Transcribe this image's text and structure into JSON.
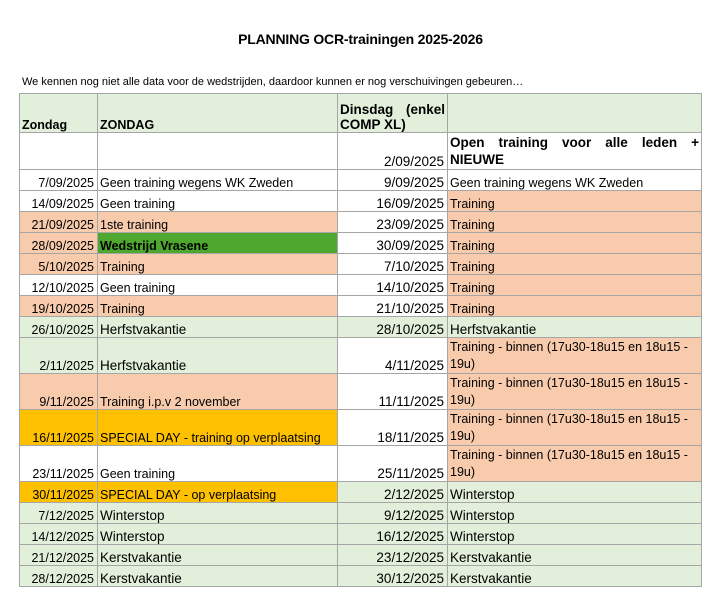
{
  "title": "PLANNING OCR-trainingen 2025-2026",
  "note": "We kennen nog niet alle data voor de wedstrijden, daardoor kunnen er nog verschuivingen gebeuren…",
  "header": {
    "col1": "Zondag",
    "col2": "ZONDAG",
    "col3": "Dinsdag (enkel COMP XL)",
    "col4": ""
  },
  "rows": [
    {
      "d1": "",
      "t1": "",
      "d2": "2/09/2025",
      "t2": "Open training voor alle leden + NIEUWE"
    },
    {
      "d1": "7/09/2025",
      "t1": "Geen training wegens WK Zweden",
      "d2": "9/09/2025",
      "t2": "Geen training wegens WK Zweden"
    },
    {
      "d1": "14/09/2025",
      "t1": "Geen training",
      "d2": "16/09/2025",
      "t2": "Training"
    },
    {
      "d1": "21/09/2025",
      "t1": "1ste training",
      "d2": "23/09/2025",
      "t2": "Training"
    },
    {
      "d1": "28/09/2025",
      "t1": "Wedstrijd Vrasene",
      "d2": "30/09/2025",
      "t2": "Training"
    },
    {
      "d1": "5/10/2025",
      "t1": "Training",
      "d2": "7/10/2025",
      "t2": "Training"
    },
    {
      "d1": "12/10/2025",
      "t1": "Geen training",
      "d2": "14/10/2025",
      "t2": "Training"
    },
    {
      "d1": "19/10/2025",
      "t1": "Training",
      "d2": "21/10/2025",
      "t2": "Training"
    },
    {
      "d1": "26/10/2025",
      "t1": "Herfstvakantie",
      "d2": "28/10/2025",
      "t2": "Herfstvakantie"
    },
    {
      "d1": "2/11/2025",
      "t1": "Herfstvakantie",
      "d2": "4/11/2025",
      "t2": "Training - binnen (17u30-18u15 en 18u15 - 19u)"
    },
    {
      "d1": "9/11/2025",
      "t1": "Training i.p.v 2 november",
      "d2": "11/11/2025",
      "t2": "Training - binnen (17u30-18u15 en 18u15 - 19u)"
    },
    {
      "d1": "16/11/2025",
      "t1": "SPECIAL DAY - training op verplaatsing",
      "d2": "18/11/2025",
      "t2": "Training - binnen (17u30-18u15 en 18u15 - 19u)"
    },
    {
      "d1": "23/11/2025",
      "t1": "Geen training",
      "d2": "25/11/2025",
      "t2": "Training - binnen (17u30-18u15 en 18u15 - 19u)"
    },
    {
      "d1": "30/11/2025",
      "t1": "SPECIAL DAY - op verplaatsing",
      "d2": "2/12/2025",
      "t2": "Winterstop"
    },
    {
      "d1": "7/12/2025",
      "t1": "Winterstop",
      "d2": "9/12/2025",
      "t2": "Winterstop"
    },
    {
      "d1": "14/12/2025",
      "t1": "Winterstop",
      "d2": "16/12/2025",
      "t2": "Winterstop"
    },
    {
      "d1": "21/12/2025",
      "t1": "Kerstvakantie",
      "d2": "23/12/2025",
      "t2": "Kerstvakantie"
    },
    {
      "d1": "28/12/2025",
      "t1": "Kerstvakantie",
      "d2": "30/12/2025",
      "t2": "Kerstvakantie"
    }
  ],
  "colors": {
    "green_light": "#e2efda",
    "pink": "#f8cbad",
    "green_dark": "#4ea72e",
    "orange": "#ffc000",
    "white": "#ffffff"
  }
}
